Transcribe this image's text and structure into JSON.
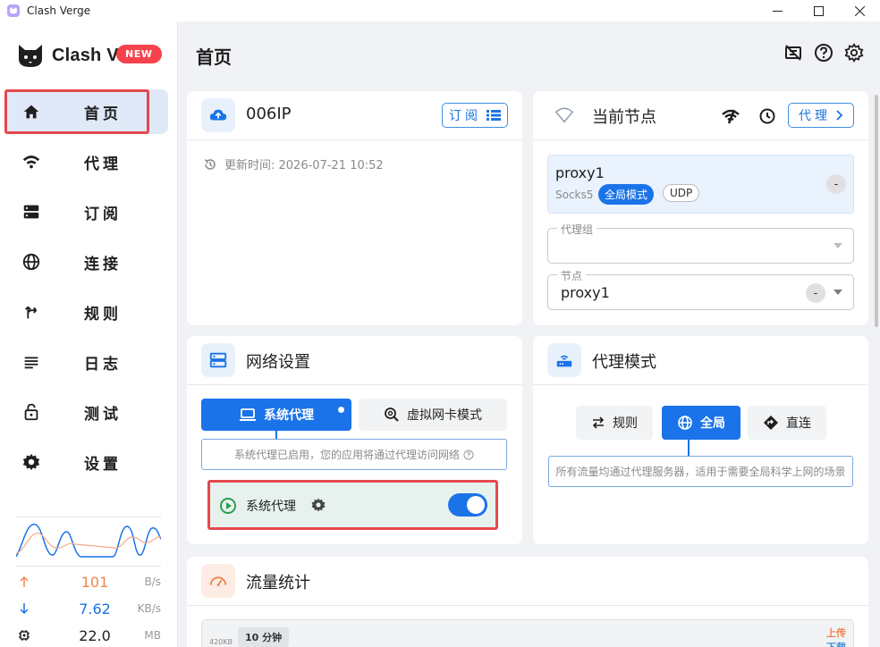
{
  "window": {
    "title": "Clash Verge"
  },
  "brand": {
    "name": "Clash Verge",
    "badge": "NEW"
  },
  "nav": [
    {
      "label": "首页",
      "icon": "home-icon",
      "active": true
    },
    {
      "label": "代理",
      "icon": "wifi-icon"
    },
    {
      "label": "订阅",
      "icon": "storage-icon"
    },
    {
      "label": "连接",
      "icon": "globe-icon"
    },
    {
      "label": "规则",
      "icon": "fork-icon"
    },
    {
      "label": "日志",
      "icon": "lines-icon"
    },
    {
      "label": "测试",
      "icon": "lock-icon"
    },
    {
      "label": "设置",
      "icon": "gear-icon"
    }
  ],
  "stats": {
    "upload": {
      "value": "101",
      "unit": "B/s",
      "color": "#f0844e"
    },
    "download": {
      "value": "7.62",
      "unit": "KB/s",
      "color": "#1a73e8"
    },
    "memory": {
      "value": "22.0",
      "unit": "MB"
    }
  },
  "header": {
    "title": "首页"
  },
  "profile_card": {
    "title": "006IP",
    "subscribe_button": "订阅",
    "update_label": "更新时间: 2026-07-21 10:52"
  },
  "node_card": {
    "title": "当前节点",
    "proxy_button": "代理",
    "current": {
      "name": "proxy1",
      "type": "Socks5",
      "tag_mode": "全局模式",
      "tag_udp": "UDP",
      "delay": "-"
    },
    "group_field": {
      "label": "代理组",
      "value": ""
    },
    "node_field": {
      "label": "节点",
      "value": "proxy1",
      "delay": "-"
    }
  },
  "network_card": {
    "title": "网络设置",
    "tab_system": "系统代理",
    "tab_tun": "虚拟网卡模式",
    "info": "系统代理已启用，您的应用将通过代理访问网络",
    "row_label": "系统代理",
    "enabled": true
  },
  "mode_card": {
    "title": "代理模式",
    "modes": [
      "规则",
      "全局",
      "直连"
    ],
    "active": "全局",
    "info": "所有流量均通过代理服务器，适用于需要全局科学上网的场景"
  },
  "traffic_card": {
    "title": "流量统计",
    "range": "10 分钟",
    "y_tick": "420KB",
    "legend_up": "上传",
    "legend_down": "下载"
  },
  "colors": {
    "accent": "#1a73e8",
    "highlight": "#e5484d",
    "upload": "#f0844e"
  }
}
